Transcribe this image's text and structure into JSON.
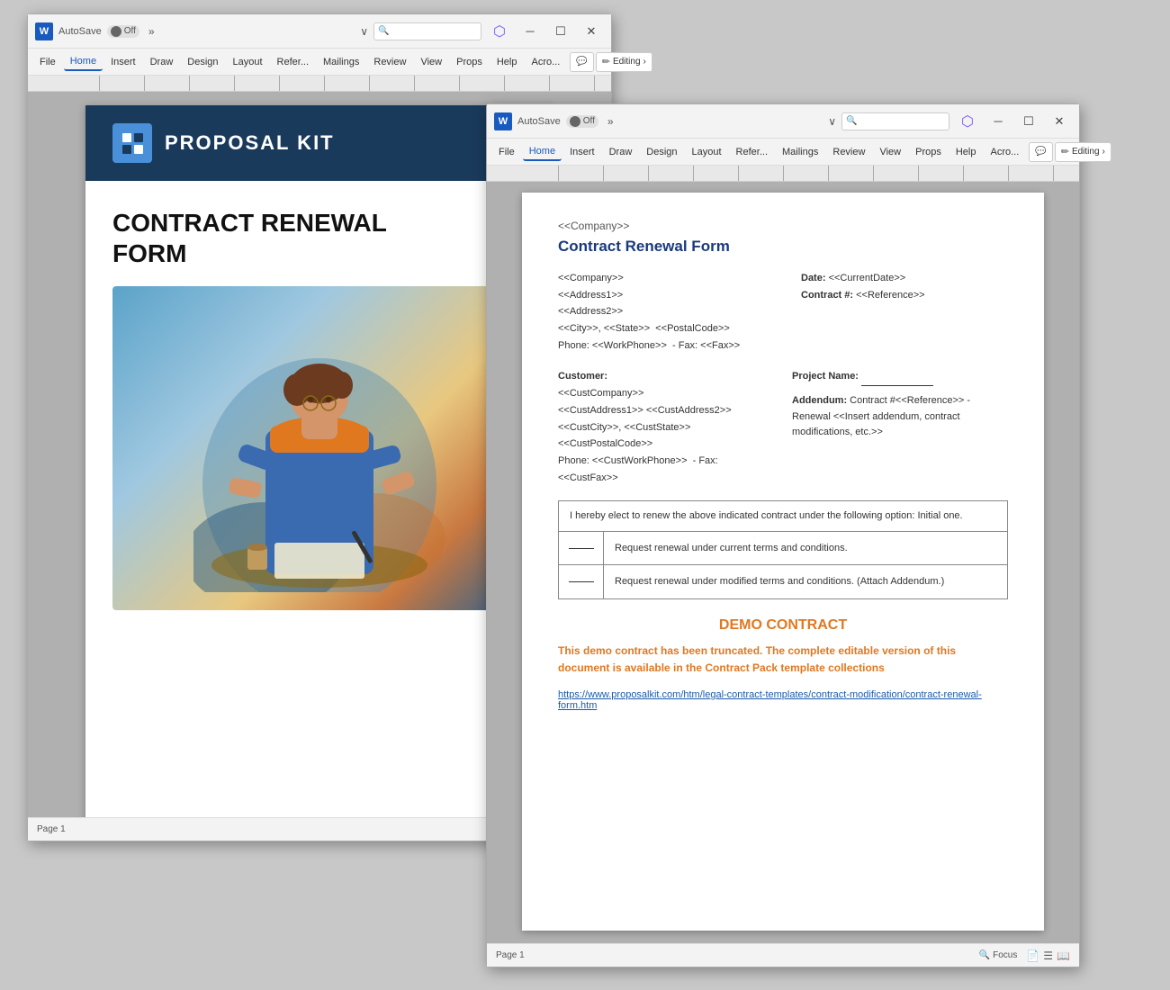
{
  "window1": {
    "title": "AutoSave",
    "toggle": "Off",
    "app_icon": "W",
    "tabs": [
      "File",
      "Home",
      "Insert",
      "Draw",
      "Design",
      "Layout",
      "References",
      "Mailings",
      "Review",
      "View",
      "Properties",
      "Help",
      "Acrobat"
    ],
    "editing_label": "Editing",
    "page_label": "Page 1",
    "cover": {
      "header_title": "Proposal Kit",
      "doc_title_line1": "CONTRACT RENEWAL",
      "doc_title_line2": "FORM"
    }
  },
  "window2": {
    "title": "AutoSave",
    "toggle": "Off",
    "app_icon": "W",
    "tabs": [
      "File",
      "Home",
      "Insert",
      "Draw",
      "Design",
      "Layout",
      "References",
      "Mailings",
      "Review",
      "View",
      "Properties",
      "Help",
      "Acrobat"
    ],
    "editing_label": "Editing",
    "page_label": "Page 1",
    "form": {
      "company_placeholder": "<<Company>>",
      "form_title": "Contract Renewal Form",
      "addr_left": [
        "<<Company>>",
        "<<Address1>>",
        "<<Address2>>",
        "<<City>>, <<State>>  <<PostalCode>>",
        "Phone: <<WorkPhone>>  - Fax: <<Fax>>"
      ],
      "addr_right_date_label": "Date:",
      "addr_right_date_value": "<<CurrentDate>>",
      "addr_right_contract_label": "Contract #:",
      "addr_right_contract_value": "<<Reference>>",
      "customer_label": "Customer:",
      "customer_lines": [
        "<<CustCompany>>",
        "<<CustAddress1>> <<CustAddress2>>",
        "<<CustCity>>, <<CustState>>",
        "<<CustPostalCode>>",
        "Phone: <<CustWorkPhone>>  - Fax:",
        "<<CustFax>>"
      ],
      "project_name_label": "Project Name:",
      "project_name_value": "_________",
      "addendum_label": "Addendum:",
      "addendum_value": "Contract #<<Reference>> - Renewal <<Insert addendum, contract modifications, etc.>>",
      "renewal_intro": "I hereby elect to renew the above indicated contract under the following option: Initial one.",
      "renewal_options": [
        "Request renewal under current terms and conditions.",
        "Request renewal under modified terms and conditions. (Attach Addendum.)"
      ],
      "demo_title": "DEMO CONTRACT",
      "demo_body": "This demo contract has been truncated. The complete editable version of this document is available in the Contract Pack template collections",
      "demo_link": "https://www.proposalkit.com/htm/legal-contract-templates/contract-modification/contract-renewal-form.htm"
    }
  }
}
